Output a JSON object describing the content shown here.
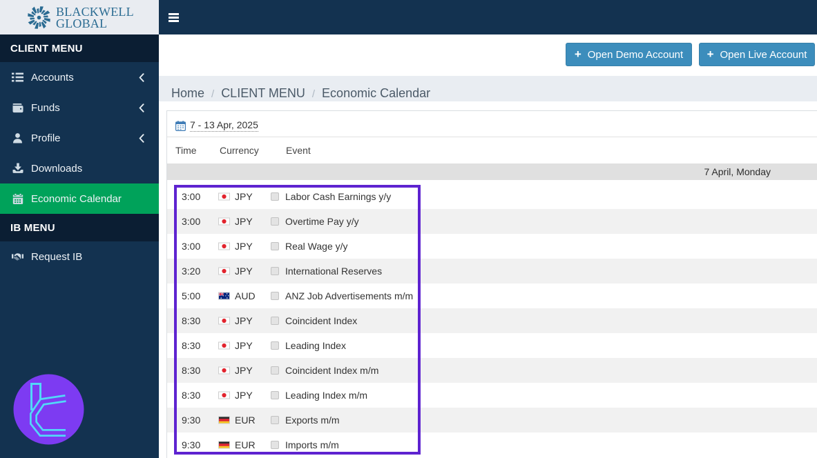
{
  "brand": {
    "line1": "BLACKWELL",
    "line2": "GLOBAL"
  },
  "sidebar": {
    "sections": [
      {
        "header": "CLIENT MENU",
        "items": [
          {
            "label": "Accounts",
            "icon": "list-icon",
            "chevron": true,
            "active": false
          },
          {
            "label": "Funds",
            "icon": "wallet-icon",
            "chevron": true,
            "active": false
          },
          {
            "label": "Profile",
            "icon": "user-icon",
            "chevron": true,
            "active": false
          },
          {
            "label": "Downloads",
            "icon": "download-icon",
            "chevron": false,
            "active": false
          },
          {
            "label": "Economic Calendar",
            "icon": "calendar-icon",
            "chevron": false,
            "active": true
          }
        ]
      },
      {
        "header": "IB MENU",
        "items": [
          {
            "label": "Request IB",
            "icon": "handshake-icon",
            "chevron": false,
            "active": false
          }
        ]
      }
    ]
  },
  "header_buttons": [
    {
      "label": "Open Demo Account",
      "icon": "plus-icon"
    },
    {
      "label": "Open Live Account",
      "icon": "plus-icon"
    }
  ],
  "breadcrumb": {
    "separator": "/",
    "items": [
      "Home",
      "CLIENT MENU",
      "Economic Calendar"
    ]
  },
  "calendar": {
    "date_range": "7 - 13 Apr, 2025",
    "columns": {
      "time": "Time",
      "currency": "Currency",
      "event": "Event"
    },
    "day_header": "7 April, Monday",
    "events": [
      {
        "time": "3:00",
        "currency": "JPY",
        "flag": "jp",
        "event": "Labor Cash Earnings y/y"
      },
      {
        "time": "3:00",
        "currency": "JPY",
        "flag": "jp",
        "event": "Overtime Pay y/y"
      },
      {
        "time": "3:00",
        "currency": "JPY",
        "flag": "jp",
        "event": "Real Wage y/y"
      },
      {
        "time": "3:20",
        "currency": "JPY",
        "flag": "jp",
        "event": "International Reserves"
      },
      {
        "time": "5:00",
        "currency": "AUD",
        "flag": "au",
        "event": "ANZ Job Advertisements m/m"
      },
      {
        "time": "8:30",
        "currency": "JPY",
        "flag": "jp",
        "event": "Coincident Index"
      },
      {
        "time": "8:30",
        "currency": "JPY",
        "flag": "jp",
        "event": "Leading Index"
      },
      {
        "time": "8:30",
        "currency": "JPY",
        "flag": "jp",
        "event": "Coincident Index m/m"
      },
      {
        "time": "8:30",
        "currency": "JPY",
        "flag": "jp",
        "event": "Leading Index m/m"
      },
      {
        "time": "9:30",
        "currency": "EUR",
        "flag": "de",
        "event": "Exports m/m"
      },
      {
        "time": "9:30",
        "currency": "EUR",
        "flag": "de",
        "event": "Imports m/m"
      }
    ]
  },
  "colors": {
    "navy": "#133250",
    "navy_dark": "#0b1e33",
    "accent_green": "#00a25a",
    "primary_blue": "#3c8dbc",
    "annotation_purple": "#5e23d0",
    "watermark_purple": "#7d3bf2",
    "watermark_cyan": "#52d7f8"
  }
}
